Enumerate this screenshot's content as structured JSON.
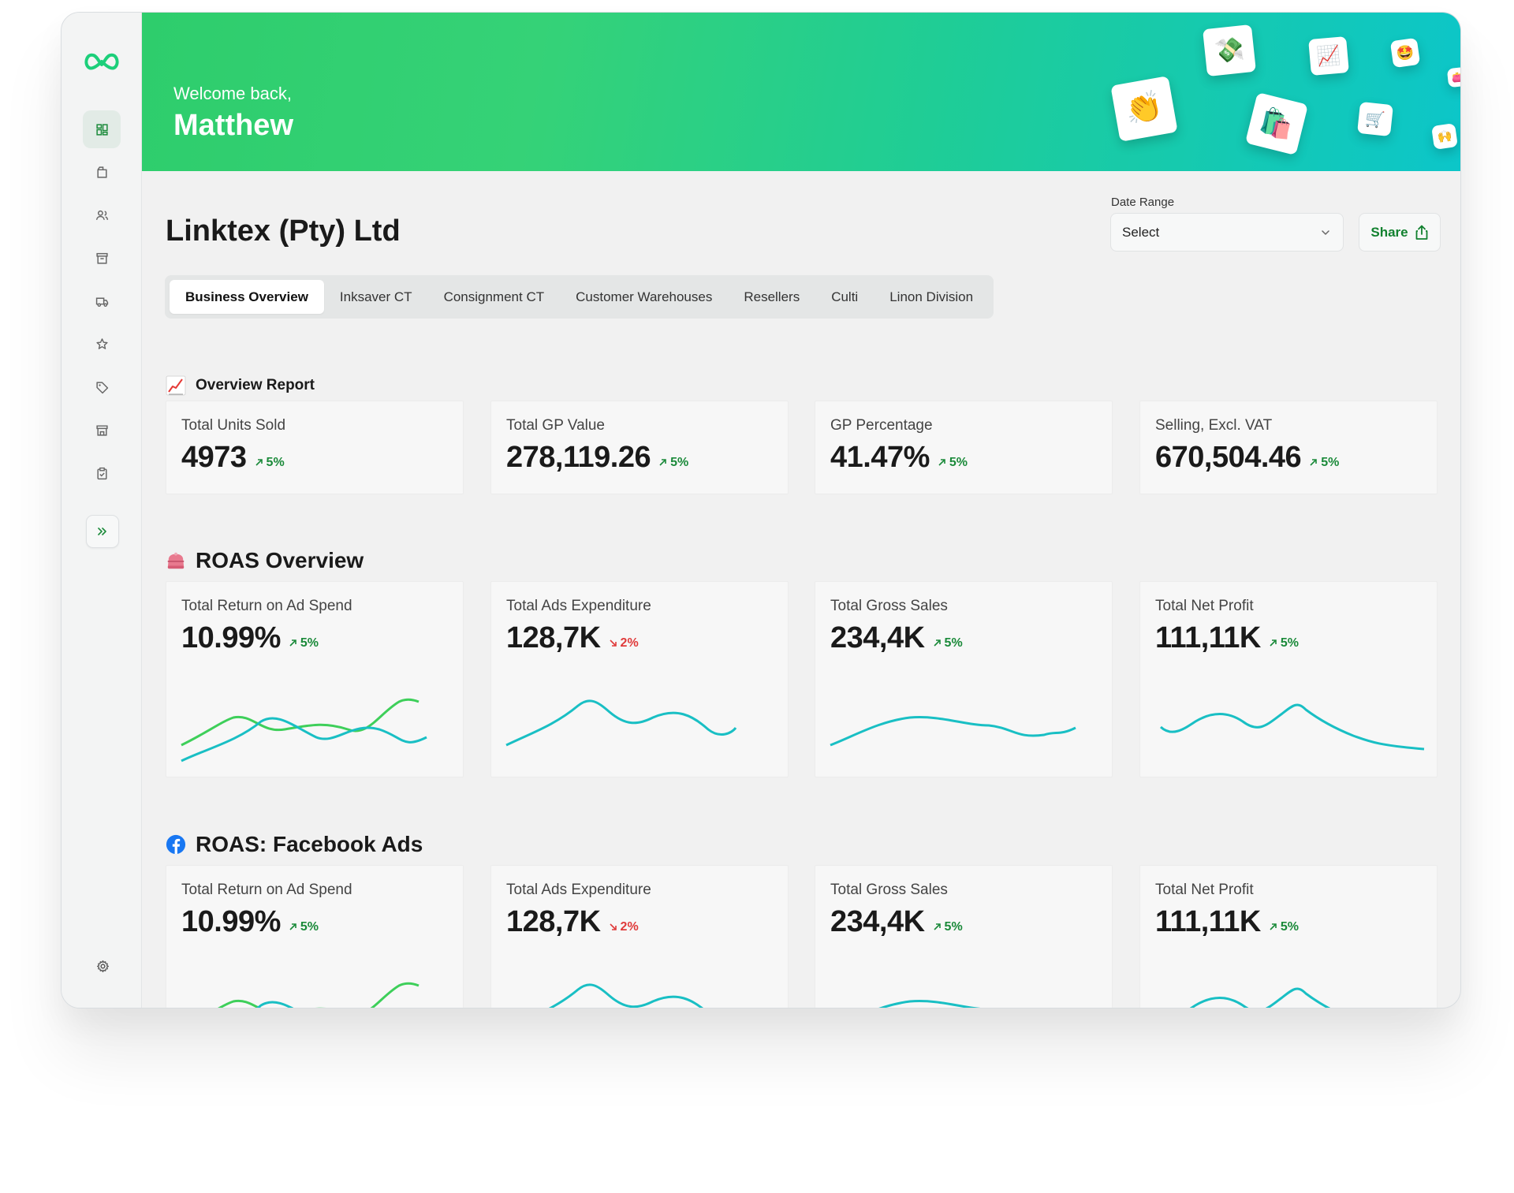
{
  "header": {
    "welcome": "Welcome back,",
    "user_name": "Matthew"
  },
  "company": {
    "name": "Linktex (Pty) Ltd"
  },
  "date_range": {
    "label": "Date Range",
    "value": "Select"
  },
  "share": {
    "label": "Share"
  },
  "tabs": [
    {
      "label": "Business Overview",
      "active": true
    },
    {
      "label": "Inksaver CT"
    },
    {
      "label": "Consignment CT"
    },
    {
      "label": "Customer Warehouses"
    },
    {
      "label": "Resellers"
    },
    {
      "label": "Culti"
    },
    {
      "label": "Linon Division"
    }
  ],
  "sidebar": {
    "items": [
      {
        "icon": "dashboard-icon",
        "active": true
      },
      {
        "icon": "box-icon"
      },
      {
        "icon": "users-icon"
      },
      {
        "icon": "archive-icon"
      },
      {
        "icon": "truck-icon"
      },
      {
        "icon": "star-icon"
      },
      {
        "icon": "tag-icon"
      },
      {
        "icon": "store-icon"
      },
      {
        "icon": "clipboard-icon"
      }
    ],
    "expand_icon": "chevrons-right-icon",
    "settings_icon": "gear-icon"
  },
  "overview": {
    "title": "Overview Report",
    "icon": "chart-increasing-icon",
    "cards": [
      {
        "label": "Total Units Sold",
        "value": "4973",
        "delta": "5%",
        "direction": "up"
      },
      {
        "label": "Total GP Value",
        "value": "278,119.26",
        "delta": "5%",
        "direction": "up"
      },
      {
        "label": "GP Percentage",
        "value": "41.47%",
        "delta": "5%",
        "direction": "up"
      },
      {
        "label": "Selling, Excl. VAT",
        "value": "670,504.46",
        "delta": "5%",
        "direction": "up"
      }
    ]
  },
  "roas": {
    "title": "ROAS Overview",
    "icon": "purse-icon",
    "cards": [
      {
        "label": "Total Return on Ad Spend",
        "value": "10.99%",
        "delta": "5%",
        "direction": "up"
      },
      {
        "label": "Total Ads Expenditure",
        "value": "128,7K",
        "delta": "2%",
        "direction": "down"
      },
      {
        "label": "Total Gross Sales",
        "value": "234,4K",
        "delta": "5%",
        "direction": "up"
      },
      {
        "label": "Total Net Profit",
        "value": "111,11K",
        "delta": "5%",
        "direction": "up"
      }
    ]
  },
  "facebook": {
    "title": "ROAS: Facebook Ads",
    "icon": "facebook-icon",
    "cards": [
      {
        "label": "Total Return on Ad Spend",
        "value": "10.99%",
        "delta": "5%",
        "direction": "up"
      },
      {
        "label": "Total Ads Expenditure",
        "value": "128,7K",
        "delta": "2%",
        "direction": "down"
      },
      {
        "label": "Total Gross Sales",
        "value": "234,4K",
        "delta": "5%",
        "direction": "up"
      },
      {
        "label": "Total Net Profit",
        "value": "111,11K",
        "delta": "5%",
        "direction": "up"
      }
    ]
  },
  "colors": {
    "accent_green": "#12812f",
    "spark_teal": "#19bfc4",
    "spark_green": "#3ecf5a",
    "down_red": "#e03b3b"
  }
}
